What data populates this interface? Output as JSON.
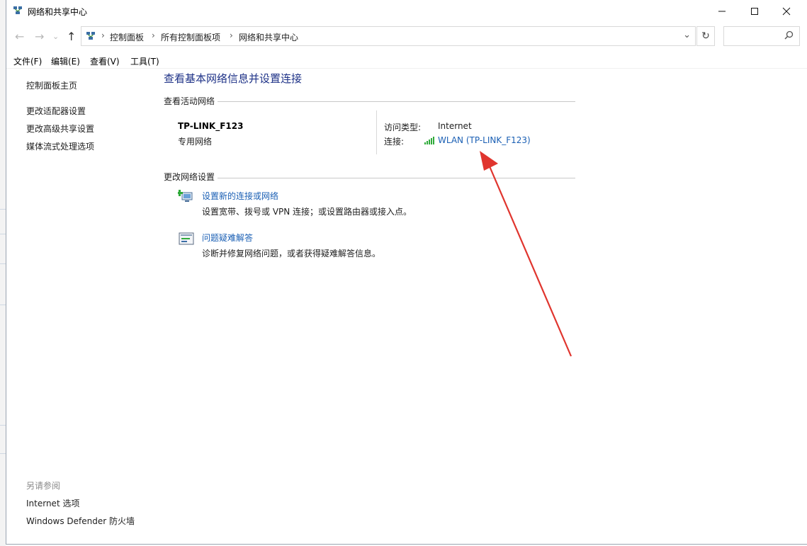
{
  "window": {
    "title": "网络和共享中心"
  },
  "titlebar": {
    "minimize_icon": "minimize-icon",
    "maximize_icon": "maximize-icon",
    "close_icon": "close-icon"
  },
  "address": {
    "back": "←",
    "forward": "→",
    "dropdown": "⌄",
    "up": "↑",
    "crumbs": [
      "控制面板",
      "所有控制面板项",
      "网络和共享中心"
    ],
    "separator": "›",
    "refresh": "↻",
    "search_placeholder": ""
  },
  "menu": [
    "文件(F)",
    "编辑(E)",
    "查看(V)",
    "工具(T)"
  ],
  "sidebar": {
    "home": "控制面板主页",
    "items": [
      "更改适配器设置",
      "更改高级共享设置",
      "媒体流式处理选项"
    ],
    "see_also_title": "另请参阅",
    "see_also": [
      "Internet 选项",
      "Windows Defender 防火墙"
    ]
  },
  "main": {
    "heading": "查看基本网络信息并设置连接",
    "active_section": "查看活动网络",
    "network_name": "TP-LINK_F123",
    "network_type": "专用网络",
    "access_label": "访问类型:",
    "access_value": "Internet",
    "conn_label": "连接:",
    "conn_value": "WLAN (TP-LINK_F123)",
    "change_section": "更改网络设置",
    "tasks": [
      {
        "title": "设置新的连接或网络",
        "desc": "设置宽带、拨号或 VPN 连接；或设置路由器或接入点。"
      },
      {
        "title": "问题疑难解答",
        "desc": "诊断并修复网络问题，或者获得疑难解答信息。"
      }
    ]
  },
  "colors": {
    "link": "#1a5fb4",
    "heading": "#1e3287",
    "arrow": "#e0352e",
    "signal": "#2faa3a"
  }
}
